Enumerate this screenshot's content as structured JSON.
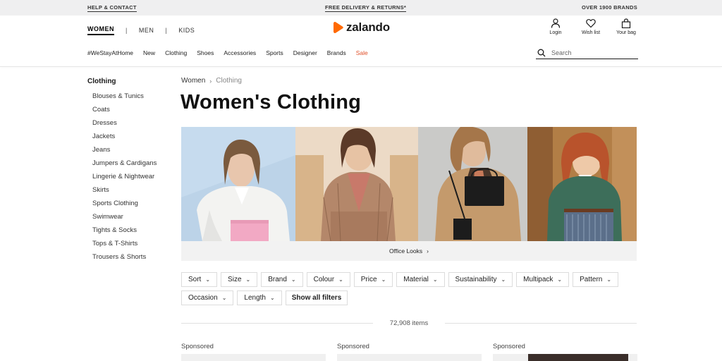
{
  "topbar": {
    "help": "HELP & CONTACT",
    "delivery": "FREE DELIVERY & RETURNS*",
    "brands": "OVER 1900 BRANDS"
  },
  "gender": [
    "WOMEN",
    "MEN",
    "KIDS"
  ],
  "logo": {
    "name": "zalando",
    "color": "#ff6900"
  },
  "account": [
    {
      "label": "Login",
      "icon": "user-icon"
    },
    {
      "label": "Wish list",
      "icon": "heart-icon"
    },
    {
      "label": "Your bag",
      "icon": "bag-icon"
    }
  ],
  "categories": [
    "#WeStayAtHome",
    "New",
    "Clothing",
    "Shoes",
    "Accessories",
    "Sports",
    "Designer",
    "Brands",
    "Sale"
  ],
  "search": {
    "placeholder": "Search"
  },
  "sidebar": {
    "title": "Clothing",
    "items": [
      "Blouses & Tunics",
      "Coats",
      "Dresses",
      "Jackets",
      "Jeans",
      "Jumpers & Cardigans",
      "Lingerie & Nightwear",
      "Skirts",
      "Sports Clothing",
      "Swimwear",
      "Tights & Socks",
      "Tops & T-Shirts",
      "Trousers & Shorts"
    ]
  },
  "breadcrumb": [
    "Women",
    "Clothing"
  ],
  "page_title": "Women's Clothing",
  "banner": {
    "caption": "Office Looks"
  },
  "filters": [
    "Sort",
    "Size",
    "Brand",
    "Colour",
    "Price",
    "Material",
    "Sustainability",
    "Multipack",
    "Pattern",
    "Occasion",
    "Length"
  ],
  "show_all_filters": "Show all filters",
  "item_count": "72,908 items",
  "sponsored": [
    "Sponsored",
    "Sponsored",
    "Sponsored"
  ],
  "colors": {
    "sale": "#e0502a",
    "accent": "#ff6900"
  }
}
